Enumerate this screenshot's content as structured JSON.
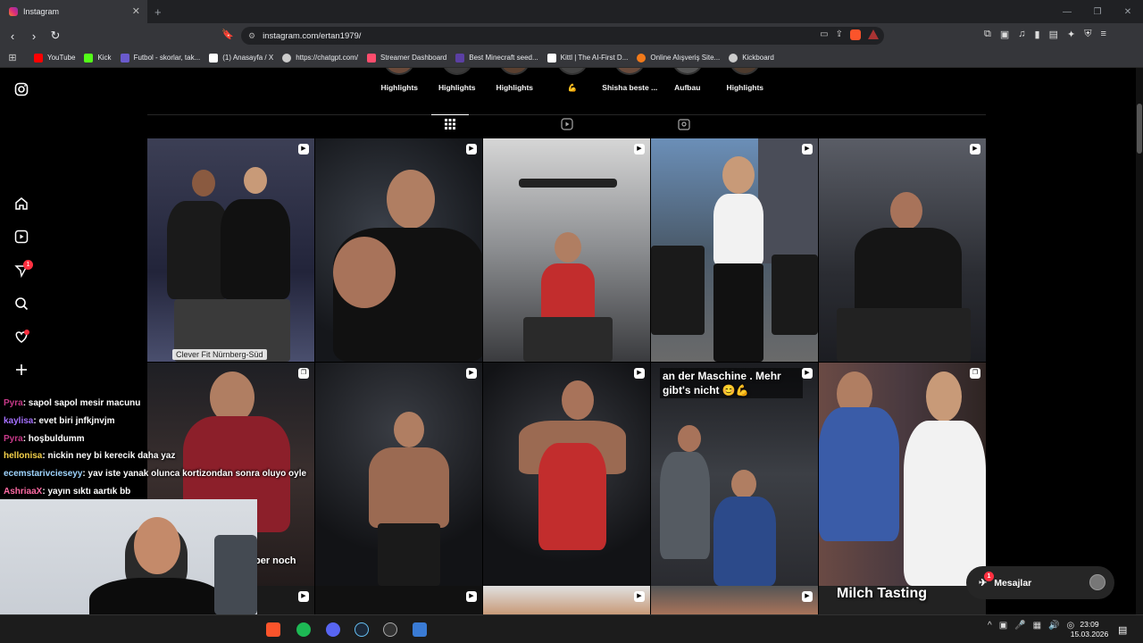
{
  "browser": {
    "tab_title": "Instagram",
    "url": "instagram.com/ertan1979/",
    "bookmarks": [
      {
        "label": "YouTube",
        "color": "#ff0000"
      },
      {
        "label": "Kick",
        "color": "#53fc18"
      },
      {
        "label": "Futbol - skorlar, tak...",
        "color": "#6a5acd"
      },
      {
        "label": "(1) Anasayfa / X",
        "color": "#ffffff"
      },
      {
        "label": "https://chatgpt.com/",
        "color": "#cccccc"
      },
      {
        "label": "Streamer Dashboard",
        "color": "#ff4d6d"
      },
      {
        "label": "Best Minecraft seed...",
        "color": "#5b3fa3"
      },
      {
        "label": "Kittl | The AI-First D...",
        "color": "#ffffff"
      },
      {
        "label": "Online Alışveriş Site...",
        "color": "#f27a1a"
      },
      {
        "label": "Kickboard",
        "color": "#cccccc"
      }
    ]
  },
  "profile": {
    "highlights": [
      "Highlights",
      "Highlights",
      "Highlights",
      "💪",
      "Shisha beste ...",
      "Aufbau",
      "Highlights"
    ]
  },
  "sidebar": {
    "notifications_badge": "1"
  },
  "posts": {
    "location": "Clever Fit Nürnberg-Süd",
    "caption_maschine": "an der Maschine . Mehr gibt's nicht 😊💪",
    "caption_noch": "ber noch",
    "caption_milch": "Milch Tasting"
  },
  "chat": [
    {
      "user": "Pyra",
      "text": ": sapol sapol mesir macunu"
    },
    {
      "user": "kaylisa",
      "text": ": evet biri jnfkjnvjm"
    },
    {
      "user": "Pyra",
      "text": ": hoşbuldumm"
    },
    {
      "user": "hellonisa",
      "text": ": nickin ney bi kerecik daha yaz"
    },
    {
      "user": "ecemstarivcieseyy",
      "text": ": yav iste yanak olunca kortizondan sonra oluyo oyle"
    },
    {
      "user": "AshriaaX",
      "text": ": yayın sıktı aartık bb"
    }
  ],
  "messages": {
    "label": "Mesajlar",
    "badge": "1"
  },
  "taskbar": {
    "time": "23:09",
    "date": "15.03.2026"
  },
  "colors": {
    "accent_red": "#ff3040",
    "background": "#000000"
  }
}
